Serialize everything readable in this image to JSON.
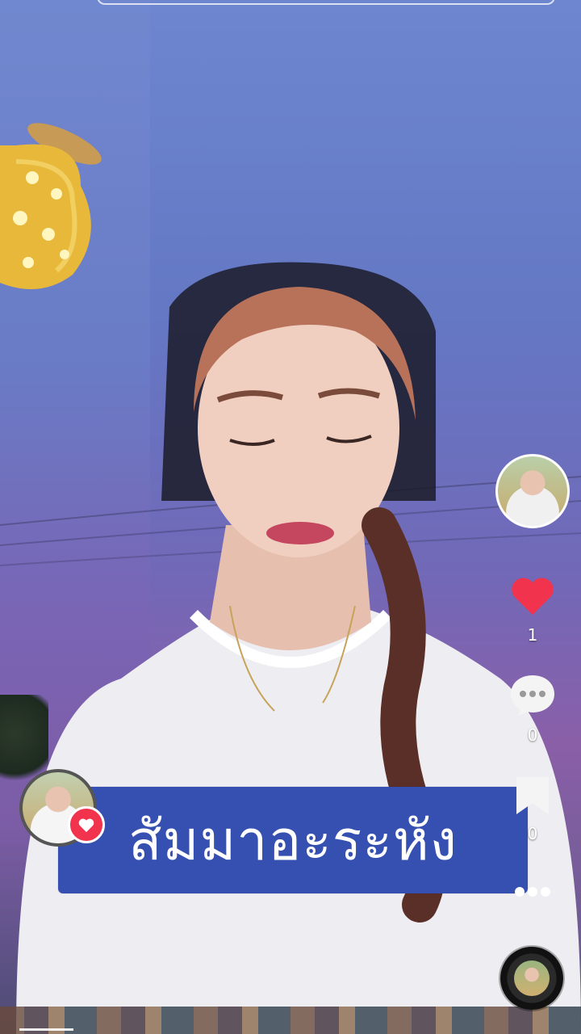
{
  "video": {
    "caption_text": "สัมมาอะระหัง",
    "progress_fraction": 0.1
  },
  "actions": {
    "like_count": "1",
    "comment_count": "0",
    "save_count": "0"
  },
  "icons": {
    "like": "heart-icon",
    "comment": "comment-bubble-icon",
    "save": "bookmark-icon",
    "more": "more-dots-icon",
    "music": "music-disc-icon",
    "follow": "heart-badge-icon"
  },
  "colors": {
    "like": "#f2334d",
    "caption_bg": "#3550b0"
  }
}
